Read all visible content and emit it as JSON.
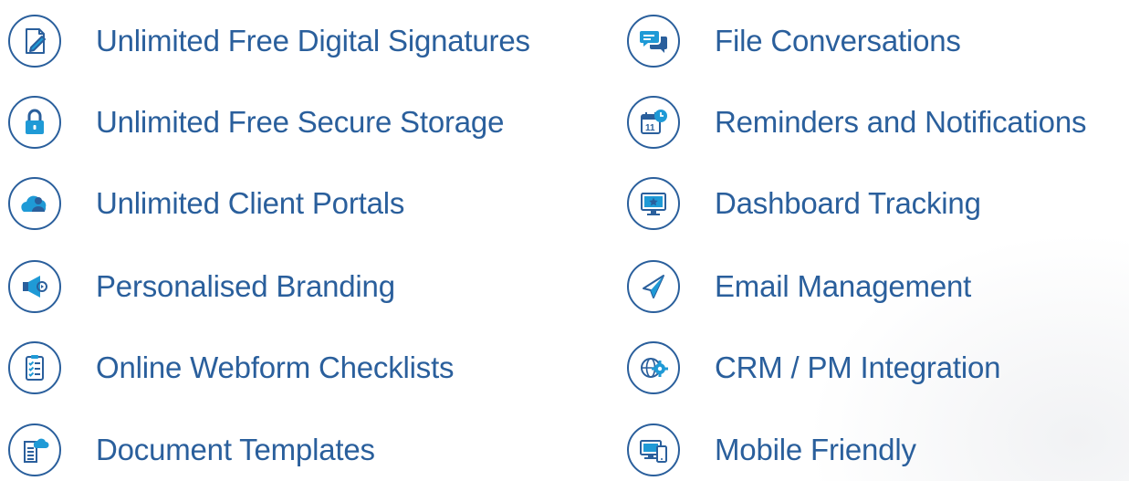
{
  "colors": {
    "brand": "#2a5f9c",
    "accent": "#1f9ad6"
  },
  "features": {
    "left": [
      {
        "label": "Unlimited Free Digital Signatures",
        "icon": "signature-document-icon"
      },
      {
        "label": "Unlimited Free Secure Storage",
        "icon": "padlock-icon"
      },
      {
        "label": "Unlimited Client Portals",
        "icon": "cloud-user-icon"
      },
      {
        "label": "Personalised Branding",
        "icon": "megaphone-icon"
      },
      {
        "label": "Online Webform Checklists",
        "icon": "clipboard-checklist-icon"
      },
      {
        "label": "Document Templates",
        "icon": "document-cloud-icon"
      }
    ],
    "right": [
      {
        "label": "File Conversations",
        "icon": "chat-bubbles-icon"
      },
      {
        "label": "Reminders and Notifications",
        "icon": "calendar-clock-icon"
      },
      {
        "label": "Dashboard Tracking",
        "icon": "monitor-star-icon"
      },
      {
        "label": "Email Management",
        "icon": "paper-plane-icon"
      },
      {
        "label": "CRM / PM Integration",
        "icon": "globe-gear-icon"
      },
      {
        "label": "Mobile Friendly",
        "icon": "devices-icon"
      }
    ]
  }
}
